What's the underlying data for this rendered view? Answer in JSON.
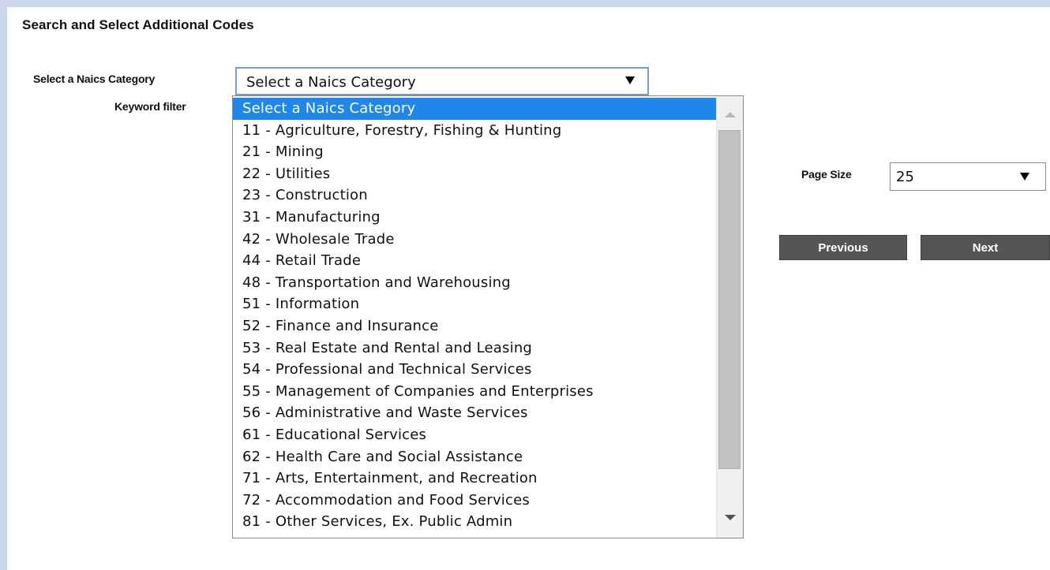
{
  "page": {
    "title": "Search and Select Additional Codes"
  },
  "form": {
    "naics_label": "Select a Naics Category",
    "keyword_label": "Keyword filter",
    "naics_selected": "Select a Naics Category",
    "page_size_label": "Page Size",
    "page_size_value": "25"
  },
  "dropdown": {
    "items": [
      {
        "label": "Select a Naics Category",
        "selected": true
      },
      {
        "label": "11 - Agriculture, Forestry, Fishing & Hunting"
      },
      {
        "label": "21 - Mining"
      },
      {
        "label": "22 - Utilities"
      },
      {
        "label": "23 - Construction"
      },
      {
        "label": "31 - Manufacturing"
      },
      {
        "label": "42 - Wholesale Trade"
      },
      {
        "label": "44 - Retail Trade"
      },
      {
        "label": "48 - Transportation and Warehousing"
      },
      {
        "label": "51 - Information"
      },
      {
        "label": "52 - Finance and Insurance"
      },
      {
        "label": "53 - Real Estate and Rental and Leasing"
      },
      {
        "label": "54 - Professional and Technical Services"
      },
      {
        "label": "55 - Management of Companies and Enterprises"
      },
      {
        "label": "56 - Administrative and Waste Services"
      },
      {
        "label": "61 - Educational Services"
      },
      {
        "label": "62 - Health Care and Social Assistance"
      },
      {
        "label": "71 - Arts, Entertainment, and Recreation"
      },
      {
        "label": "72 - Accommodation and Food Services"
      },
      {
        "label": "81 - Other Services, Ex. Public Admin"
      }
    ]
  },
  "pager": {
    "previous_label": "Previous",
    "next_label": "Next"
  },
  "colors": {
    "frame": "#ccd6e6",
    "highlight": "#1f86ea",
    "button": "#555555"
  },
  "icons": {
    "dropdown_arrow": "chevron-down-icon",
    "scroll_up": "scroll-up-icon",
    "scroll_down": "scroll-down-icon"
  }
}
